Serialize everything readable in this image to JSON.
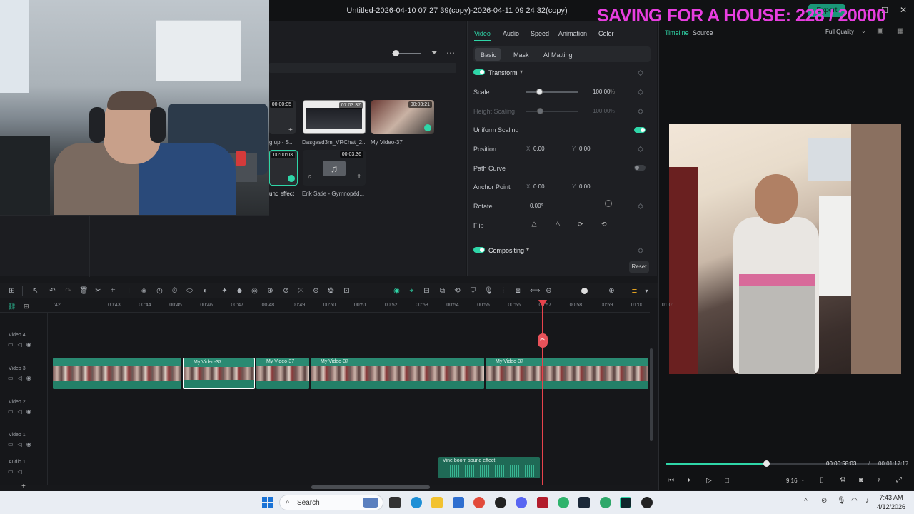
{
  "window": {
    "title": "Untitled-2026-04-10 07 27 39(copy)-2026-04-11 09 24 32(copy)",
    "overlay_banner": "SAVING FOR A HOUSE: 228 / 20000",
    "export_label": "Export"
  },
  "media": {
    "items": [
      {
        "label": "g up - S...",
        "duration": "00:00:05"
      },
      {
        "label": "Dasgasd3m_VRChat_2...",
        "duration": "07:03:37"
      },
      {
        "label": "My Video-37",
        "duration": "00:03:21"
      },
      {
        "label": "und effect",
        "duration": "00:00:03"
      },
      {
        "label": "Erik Satie - Gymnopéd...",
        "duration": "00:03:36"
      }
    ]
  },
  "props": {
    "tabs": [
      "Video",
      "Audio",
      "Speed",
      "Animation",
      "Color"
    ],
    "subtabs": [
      "Basic",
      "Mask",
      "AI Matting"
    ],
    "transform_label": "Transform",
    "scale_label": "Scale",
    "scale_value": "100.00",
    "scale_unit": "%",
    "scale_level": 0.25,
    "height_scaling_label": "Height Scaling",
    "height_scaling_value": "100.00",
    "height_scaling_unit": "%",
    "uniform_scaling_label": "Uniform Scaling",
    "position_label": "Position",
    "position_x_label": "X",
    "position_x": "0.00",
    "position_y_label": "Y",
    "position_y": "0.00",
    "path_curve_label": "Path Curve",
    "anchor_label": "Anchor Point",
    "anchor_x_label": "X",
    "anchor_x": "0.00",
    "anchor_y_label": "Y",
    "anchor_y": "0.00",
    "rotate_label": "Rotate",
    "rotate_value": "0.00°",
    "flip_label": "Flip",
    "compositing_label": "Compositing",
    "reset_label": "Reset"
  },
  "preview": {
    "tabs": [
      "Timeline",
      "Source"
    ],
    "quality": "Full Quality",
    "current_time": "00:00:58:03",
    "separator": "/",
    "total_time": "00:01:17:17",
    "aspect": "9:16",
    "progress": 0.75
  },
  "timeline": {
    "ticks": [
      ":42",
      "00:43",
      "00:44",
      "00:45",
      "00:46",
      "00:47",
      "00:48",
      "00:49",
      "00:50",
      "00:51",
      "00:52",
      "00:53",
      "00:54",
      "00:55",
      "00:56",
      "00:57",
      "00:58",
      "00:59",
      "01:00",
      "01:01"
    ],
    "tracks": [
      "Video 4",
      "Video 3",
      "Video 2",
      "Video 1",
      "Audio 1"
    ],
    "clip_label": "My Video-37",
    "audio_clip_label": "Vine boom sound effect"
  },
  "taskbar": {
    "search_placeholder": "Search",
    "time": "7:43 AM",
    "date": "4/12/2026"
  }
}
